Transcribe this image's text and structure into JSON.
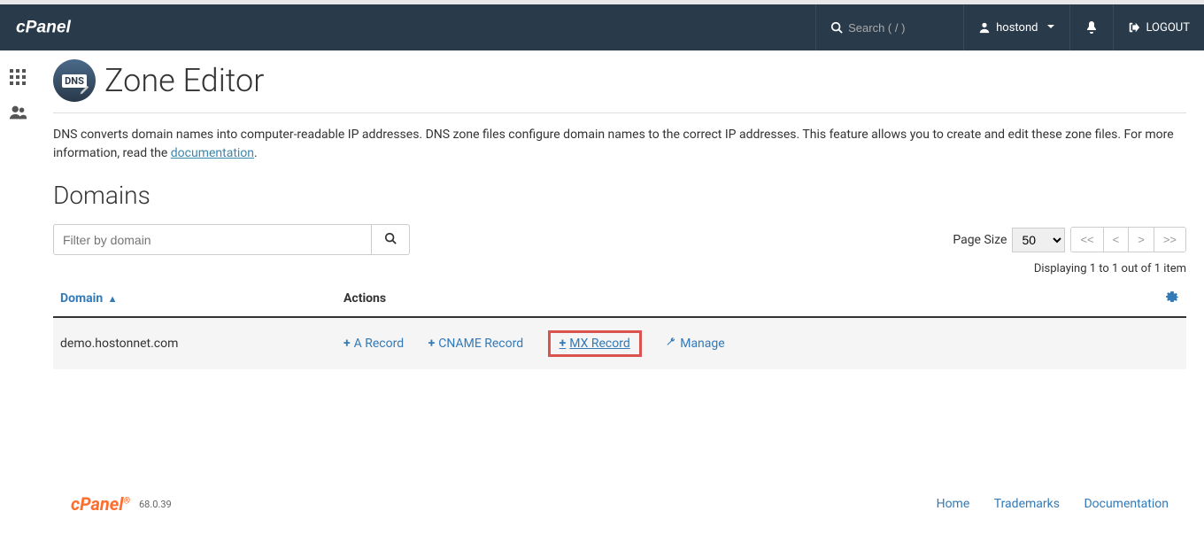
{
  "topbar": {
    "search_placeholder": "Search ( / )",
    "username": "hostond",
    "logout_label": "LOGOUT"
  },
  "page": {
    "title": "Zone Editor",
    "intro_prefix": "DNS converts domain names into computer-readable IP addresses. DNS zone files configure domain names to the correct IP addresses. This feature allows you to create and edit these zone files. For more information, read the ",
    "doc_link_text": "documentation",
    "intro_suffix": "."
  },
  "domains": {
    "section_title": "Domains",
    "filter_placeholder": "Filter by domain",
    "page_size_label": "Page Size",
    "page_size_value": "50",
    "pager": {
      "first": "<<",
      "prev": "<",
      "next": ">",
      "last": ">>"
    },
    "displaying": "Displaying 1 to 1 out of 1 item",
    "columns": {
      "domain": "Domain",
      "actions": "Actions"
    },
    "rows": [
      {
        "domain": "demo.hostonnet.com",
        "a_record": "A Record",
        "cname_record": "CNAME Record",
        "mx_record": "MX Record",
        "manage": "Manage"
      }
    ]
  },
  "footer": {
    "version": "68.0.39",
    "links": {
      "home": "Home",
      "trademarks": "Trademarks",
      "documentation": "Documentation"
    }
  }
}
